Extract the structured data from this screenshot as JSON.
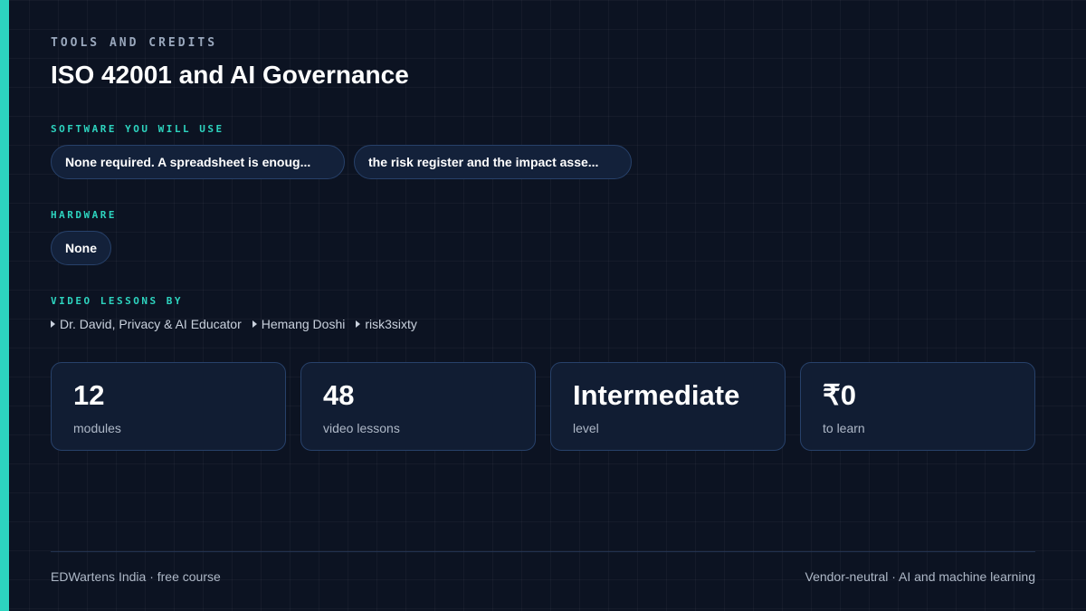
{
  "header": {
    "eyebrow": "TOOLS AND CREDITS",
    "title": "ISO 42001 and AI Governance"
  },
  "software": {
    "label": "SOFTWARE YOU WILL USE",
    "items": [
      "None required. A spreadsheet is enoug...",
      "the risk register and the impact asse..."
    ]
  },
  "hardware": {
    "label": "HARDWARE",
    "items": [
      "None"
    ]
  },
  "video": {
    "label": "VIDEO LESSONS BY",
    "instructors": [
      "Dr. David, Privacy & AI Educator",
      "Hemang Doshi",
      "risk3sixty"
    ]
  },
  "stats": [
    {
      "value": "12",
      "label": "modules"
    },
    {
      "value": "48",
      "label": "video lessons"
    },
    {
      "value": "Intermediate",
      "label": "level"
    },
    {
      "value": "₹0",
      "label": "to learn"
    }
  ],
  "footer": {
    "left": "EDWartens India · free course",
    "right": "Vendor-neutral · AI and machine learning"
  },
  "colors": {
    "background": "#0c1322",
    "accent": "#2dd4bf",
    "card_border": "#27416a"
  }
}
